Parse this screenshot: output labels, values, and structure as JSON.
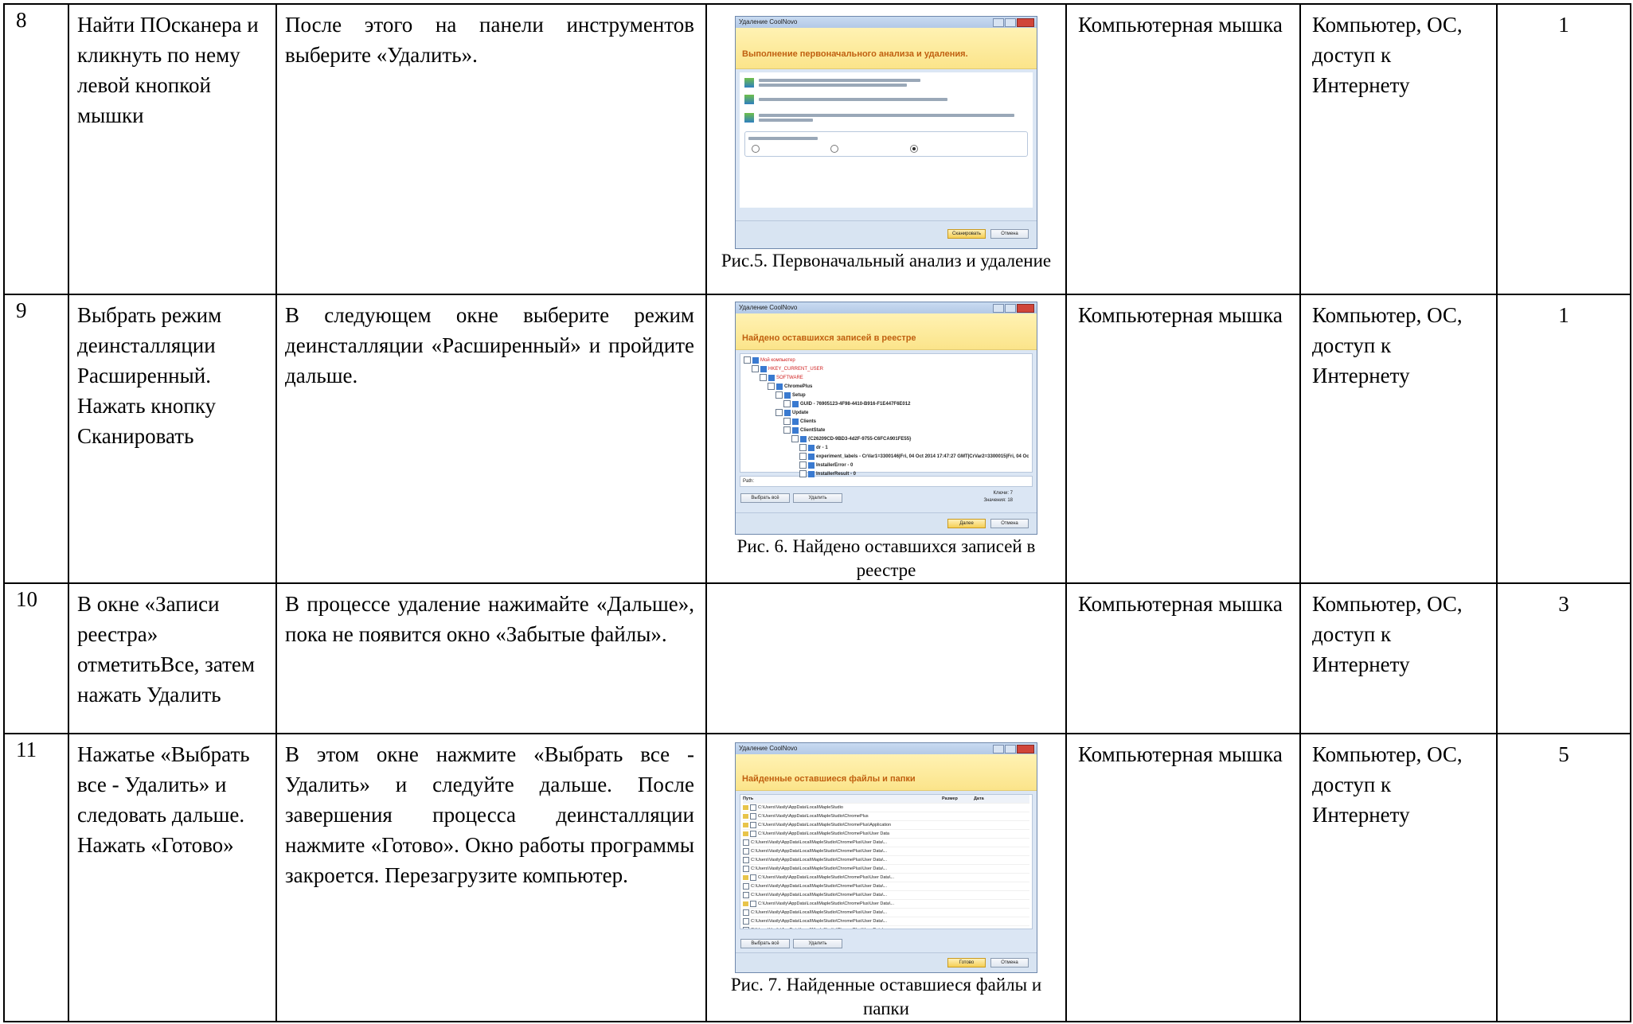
{
  "rows": [
    {
      "num": "8",
      "action": "Найти ПОсканера и кликнуть по нему левой кнопкой мышки",
      "description": "После этого на панели инструментов выберите «Удалить».",
      "figure": {
        "caption": "Рис.5. Первоначальный анализ и удаление",
        "window_title": "Удаление CoolNovo",
        "banner": "Выполнение первоначального анализа и удаления.",
        "primary_button": "Сканировать",
        "secondary_button": "Отмена"
      },
      "result": "Компьютерная мышка",
      "tools": "Компьютер, ОС, доступ к Интернету",
      "time": "1"
    },
    {
      "num": "9",
      "action": "Выбрать режим деинсталляции Расширенный. Нажать кнопку Сканировать",
      "description": "В следующем окне выберите режим деинсталляции «Расширенный» и пройдите дальше.",
      "figure": {
        "caption": "Рис. 6. Найдено оставшихся записей в реестре",
        "window_title": "Удаление CoolNovo",
        "banner": "Найдено оставшихся записей в реестре",
        "path_label": "Path:",
        "select_all": "Выбрать всё",
        "delete": "Удалить",
        "primary_button": "Далее",
        "secondary_button": "Отмена",
        "keys_label": "Ключи: 7",
        "values_label": "Значения: 18"
      },
      "result": "Компьютерная мышка",
      "tools": "Компьютер, ОС, доступ к Интернету",
      "time": "1"
    },
    {
      "num": "10",
      "action": "В окне «Записи реестра» отметитьВсе, затем нажать Удалить",
      "description": "В процессе удаление нажимайте «Дальше», пока не появится окно «Забытые файлы».",
      "figure": null,
      "result": "Компьютерная мышка",
      "tools": "Компьютер, ОС, доступ к Интернету",
      "time": "3"
    },
    {
      "num": "11",
      "action": "Нажатье «Выбрать все - Удалить» и следовать дальше. Нажать «Готово»",
      "description": "В этом окне нажмите «Выбрать все - Удалить» и следуйте дальше. После завершения процесса деинсталляции нажмите «Готово». Окно работы программы закроется. Перезагрузите компьютер.",
      "figure": {
        "caption": "Рис. 7. Найденные оставшиеся файлы и папки",
        "window_title": "Удаление CoolNovo",
        "banner": "Найденные оставшиеся файлы и папки",
        "col_path": "Путь",
        "col_size": "Размер",
        "col_date": "Дата",
        "select_all": "Выбрать всё",
        "delete": "Удалить",
        "primary_button": "Готово",
        "secondary_button": "Отмена"
      },
      "result": "Компьютерная мышка",
      "tools": "Компьютер, ОС, доступ к Интернету",
      "time": "5"
    }
  ]
}
